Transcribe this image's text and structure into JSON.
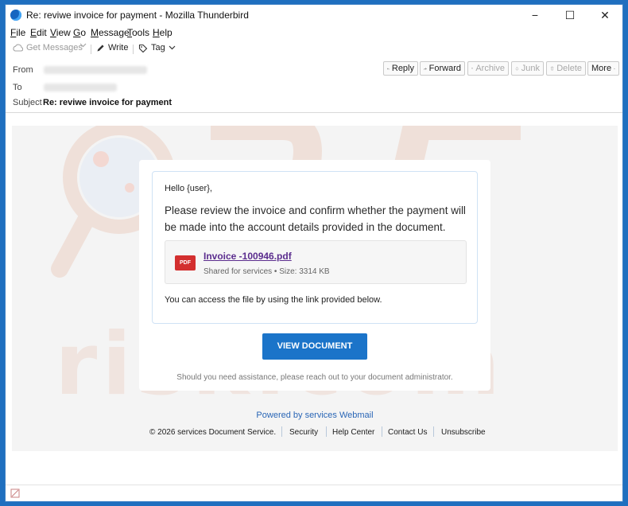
{
  "window": {
    "title": "Re: reviwe invoice for payment - Mozilla Thunderbird",
    "controls": {
      "minimize": "−",
      "maximize": "☐",
      "close": "✕"
    }
  },
  "menu": {
    "items": [
      {
        "label": "File",
        "key": "F",
        "rest": "ile"
      },
      {
        "label": "Edit",
        "key": "E",
        "rest": "dit"
      },
      {
        "label": "View",
        "key": "V",
        "rest": "iew"
      },
      {
        "label": "Go",
        "key": "G",
        "rest": "o"
      },
      {
        "label": "Message",
        "key": "M",
        "rest": "essage"
      },
      {
        "label": "Tools",
        "key": "T",
        "rest": "ools"
      },
      {
        "label": "Help",
        "key": "H",
        "rest": "elp"
      }
    ]
  },
  "toolbar": {
    "get_messages": "Get Messages",
    "write": "Write",
    "tag": "Tag"
  },
  "header": {
    "from_label": "From",
    "to_label": "To",
    "subject_label": "Subject",
    "subject_value": "Re: reviwe invoice for payment",
    "buttons": {
      "reply": "Reply",
      "forward": "Forward",
      "archive": "Archive",
      "junk": "Junk",
      "delete": "Delete",
      "more": "More"
    }
  },
  "email": {
    "greeting": "Hello {user},",
    "paragraph": "Please review the invoice and confirm whether the payment will be made into the account details provided in the document.",
    "attachment": {
      "icon_label": "PDF",
      "filename": "Invoice -100946.pdf",
      "meta": "Shared for services • Size: 3314 KB"
    },
    "access_text": "You can access the file by using the link provided below.",
    "cta": "VIEW DOCUMENT",
    "assistance": "Should you need assistance, please reach out to your document administrator.",
    "powered_by": "Powered by services Webmail",
    "footer": {
      "copyright": "© 2026 services Document Service.",
      "links": [
        "Security",
        "Help Center",
        "Contact Us",
        "Unsubscribe"
      ]
    }
  },
  "watermark": {
    "text": "risk.com",
    "color": "#f0e2dc"
  },
  "colors": {
    "accent": "#1b74c9",
    "link": "#2a66b6",
    "file_link": "#5b2d8e",
    "pdf": "#d32f2f"
  }
}
